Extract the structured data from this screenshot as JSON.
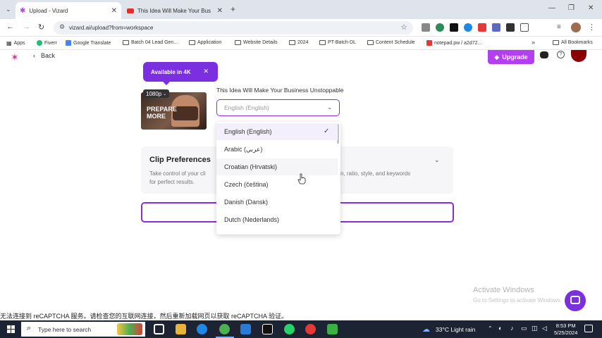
{
  "browser": {
    "tabs": [
      {
        "title": "Upload - Vizard",
        "active": true
      },
      {
        "title": "This Idea Will Make Your Busine",
        "active": false
      }
    ],
    "url": "vizard.ai/upload?from=workspace",
    "bookmarks": [
      "Apps",
      "Fiverr",
      "Google Translate",
      "Batch 04 Lead Gen...",
      "Application",
      "Website Details",
      "2024",
      "PT-Batch-DL",
      "Content Schedule",
      "notepad.pw / a2d72...",
      "All Bookmarks"
    ]
  },
  "app": {
    "back_label": "Back",
    "upgrade_label": "Upgrade",
    "badge_4k": "Available in 4K",
    "resolution_tag": "1080p",
    "thumbnail_caption": "PREPARE MORE",
    "video_title": "This Idea Will Make Your Business Unstoppable",
    "language_select": {
      "selected": "English (English)"
    },
    "language_options": [
      "English (English)",
      "Arabic (عربي)",
      "Croatian (Hrvatski)",
      "Czech (čeština)",
      "Danish (Dansk)",
      "Dutch (Nederlands)"
    ],
    "clip_preferences": {
      "title": "Clip Preferences",
      "desc_left_1": "Take control of your cli",
      "desc_right_1": "n, ratio, style, and keywords",
      "desc_left_2": "for perfect results."
    }
  },
  "overlay": {
    "activate_title": "Activate Windows",
    "activate_sub": "Go to Settings to activate Windows.",
    "recaptcha_error": "无法连接到 reCAPTCHA 服务。请检查您的互联网连接，然后重新加载网页以获取 reCAPTCHA 验证。"
  },
  "taskbar": {
    "search_placeholder": "Type here to search",
    "weather": "33°C  Light rain",
    "time": "8:53 PM",
    "date": "5/25/2024"
  },
  "colors": {
    "accent": "#7b2fe0",
    "upgrade": "#b33ef2",
    "taskbar": "#1c2433"
  }
}
